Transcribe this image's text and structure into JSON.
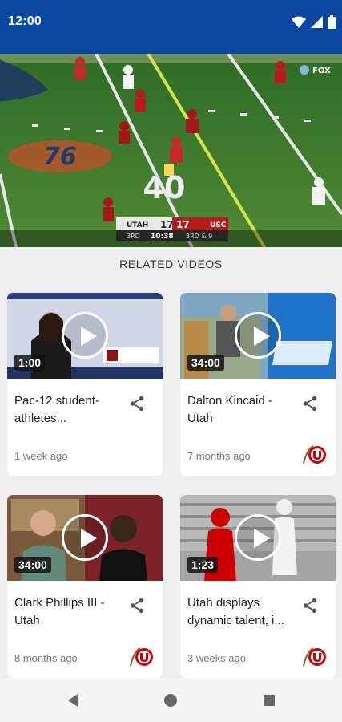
{
  "status_bar": {
    "time": "12:00"
  },
  "hero": {
    "scoreboard": {
      "home_team": "UTAH",
      "home_score": "17",
      "away_team": "USC",
      "away_score": "17",
      "quarter": "3RD",
      "clock": "10:38",
      "down": "3RD & 9"
    },
    "field_numbers": [
      "76",
      "40"
    ],
    "network": "FOX"
  },
  "section": {
    "title": "RELATED VIDEOS"
  },
  "videos": [
    {
      "title": "Pac-12 student-athletes...",
      "duration": "1:00",
      "date": "1 week ago",
      "has_logo": false
    },
    {
      "title": "Dalton Kincaid - Utah",
      "duration": "34:00",
      "date": "7 months ago",
      "has_logo": true
    },
    {
      "title": "Clark Phillips III - Utah",
      "duration": "34:00",
      "date": "8 months ago",
      "has_logo": true
    },
    {
      "title": "Utah displays dynamic talent, i...",
      "duration": "1:23",
      "date": "3 weeks ago",
      "has_logo": true
    }
  ],
  "colors": {
    "status_bar": "#0a47a1",
    "utah_red": "#cc0000",
    "background": "#eeeeee"
  }
}
